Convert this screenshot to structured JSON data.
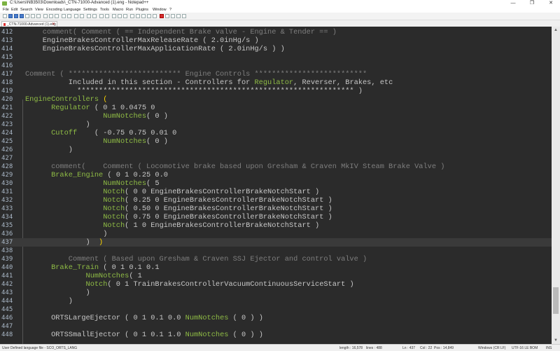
{
  "window": {
    "title": "C:\\Users\\NB3503\\Downloads\\_CTN-71000-Advanced (1).eng - Notepad++",
    "controls": [
      "—",
      "❐",
      "✕"
    ]
  },
  "menu": [
    "File",
    "Edit",
    "Search",
    "View",
    "Encoding",
    "Language",
    "Settings",
    "Tools",
    "Macro",
    "Run",
    "Plugins",
    "Window",
    "?"
  ],
  "tab": {
    "label": "_CTN-71000-Advanced (1).eng",
    "close": "✕"
  },
  "lines": [
    {
      "n": "412",
      "segs": [
        {
          "t": "    comment( Comment ( == Independent Brake valve - Engine & Tender == )",
          "c": "c"
        }
      ]
    },
    {
      "n": "413",
      "segs": [
        {
          "t": "    EngineBrakesControllerMaxReleaseRate ( 2.0inHg/s )",
          "c": "k"
        }
      ]
    },
    {
      "n": "414",
      "segs": [
        {
          "t": "    EngineBrakesControllerMaxApplicationRate ( 2.0inHg/s ) )",
          "c": "k"
        }
      ]
    },
    {
      "n": "415",
      "segs": []
    },
    {
      "n": "416",
      "segs": []
    },
    {
      "n": "417",
      "segs": [
        {
          "t": "Comment ( ************************** Engine Controls **************************",
          "c": "c"
        }
      ]
    },
    {
      "n": "418",
      "segs": [
        {
          "t": "          Included in this section - Controllers for ",
          "c": "k"
        },
        {
          "t": "Regulator",
          "c": "g"
        },
        {
          "t": ", Reverser, Brakes, etc",
          "c": "k"
        }
      ]
    },
    {
      "n": "419",
      "segs": [
        {
          "t": "            **************************************************************** )",
          "c": "k"
        }
      ]
    },
    {
      "n": "420",
      "segs": [
        {
          "t": "EngineControllers ",
          "c": "g"
        },
        {
          "t": "(",
          "c": "y"
        }
      ]
    },
    {
      "n": "421",
      "segs": [
        {
          "t": "      ",
          "c": "k"
        },
        {
          "t": "Regulator",
          "c": "g"
        },
        {
          "t": " ( 0 1 0.0475 0",
          "c": "k"
        }
      ]
    },
    {
      "n": "422",
      "segs": [
        {
          "t": "                  ",
          "c": "k"
        },
        {
          "t": "NumNotches",
          "c": "g"
        },
        {
          "t": "( 0 )",
          "c": "k"
        }
      ]
    },
    {
      "n": "423",
      "segs": [
        {
          "t": "              )",
          "c": "k"
        }
      ]
    },
    {
      "n": "424",
      "segs": [
        {
          "t": "      ",
          "c": "k"
        },
        {
          "t": "Cutoff",
          "c": "g"
        },
        {
          "t": "    ( -0.75 0.75 0.01 0",
          "c": "k"
        }
      ]
    },
    {
      "n": "425",
      "segs": [
        {
          "t": "                  ",
          "c": "k"
        },
        {
          "t": "NumNotches",
          "c": "g"
        },
        {
          "t": "( 0 )",
          "c": "k"
        }
      ]
    },
    {
      "n": "426",
      "segs": [
        {
          "t": "          )",
          "c": "k"
        }
      ]
    },
    {
      "n": "427",
      "segs": []
    },
    {
      "n": "428",
      "segs": [
        {
          "t": "      comment(    Comment ( Locomotive brake based upon Gresham & Craven MkIV Steam Brake Valve )",
          "c": "c"
        }
      ]
    },
    {
      "n": "429",
      "segs": [
        {
          "t": "      ",
          "c": "k"
        },
        {
          "t": "Brake_Engine",
          "c": "g"
        },
        {
          "t": " ( 0 1 0.25 0.0",
          "c": "k"
        }
      ]
    },
    {
      "n": "430",
      "segs": [
        {
          "t": "                  ",
          "c": "k"
        },
        {
          "t": "NumNotches",
          "c": "g"
        },
        {
          "t": "( 5",
          "c": "k"
        }
      ]
    },
    {
      "n": "431",
      "segs": [
        {
          "t": "                  ",
          "c": "k"
        },
        {
          "t": "Notch",
          "c": "g"
        },
        {
          "t": "( 0 0 EngineBrakesControllerBrakeNotchStart )",
          "c": "k"
        }
      ]
    },
    {
      "n": "432",
      "segs": [
        {
          "t": "                  ",
          "c": "k"
        },
        {
          "t": "Notch",
          "c": "g"
        },
        {
          "t": "( 0.25 0 EngineBrakesControllerBrakeNotchStart )",
          "c": "k"
        }
      ]
    },
    {
      "n": "433",
      "segs": [
        {
          "t": "                  ",
          "c": "k"
        },
        {
          "t": "Notch",
          "c": "g"
        },
        {
          "t": "( 0.50 0 EngineBrakesControllerBrakeNotchStart )",
          "c": "k"
        }
      ]
    },
    {
      "n": "434",
      "segs": [
        {
          "t": "                  ",
          "c": "k"
        },
        {
          "t": "Notch",
          "c": "g"
        },
        {
          "t": "( 0.75 0 EngineBrakesControllerBrakeNotchStart )",
          "c": "k"
        }
      ]
    },
    {
      "n": "435",
      "segs": [
        {
          "t": "                  ",
          "c": "k"
        },
        {
          "t": "Notch",
          "c": "g"
        },
        {
          "t": "( 1 0 EngineBrakesControllerBrakeNotchStart )",
          "c": "k"
        }
      ]
    },
    {
      "n": "436",
      "segs": [
        {
          "t": "                  )",
          "c": "k"
        }
      ]
    },
    {
      "n": "437",
      "segs": [
        {
          "t": "              )  ",
          "c": "k"
        },
        {
          "t": ")",
          "c": "y"
        }
      ],
      "current": true
    },
    {
      "n": "438",
      "segs": []
    },
    {
      "n": "439",
      "segs": [
        {
          "t": "          Comment ( Based upon Gresham & Craven SSJ Ejector and control valve )",
          "c": "c"
        }
      ]
    },
    {
      "n": "440",
      "segs": [
        {
          "t": "      ",
          "c": "k"
        },
        {
          "t": "Brake_Train",
          "c": "g"
        },
        {
          "t": " ( 0 1 0.1 0.1",
          "c": "k"
        }
      ]
    },
    {
      "n": "441",
      "segs": [
        {
          "t": "              ",
          "c": "k"
        },
        {
          "t": "NumNotches",
          "c": "g"
        },
        {
          "t": "( 1",
          "c": "k"
        }
      ]
    },
    {
      "n": "442",
      "segs": [
        {
          "t": "              ",
          "c": "k"
        },
        {
          "t": "Notch",
          "c": "g"
        },
        {
          "t": "( 0 1 TrainBrakesControllerVacuumContinuousServiceStart )",
          "c": "k"
        }
      ]
    },
    {
      "n": "443",
      "segs": [
        {
          "t": "              )",
          "c": "k"
        }
      ]
    },
    {
      "n": "444",
      "segs": [
        {
          "t": "          )",
          "c": "k"
        }
      ]
    },
    {
      "n": "445",
      "segs": []
    },
    {
      "n": "446",
      "segs": [
        {
          "t": "      ORTSLargeEjector ( 0 1 0.1 0.0 ",
          "c": "k"
        },
        {
          "t": "NumNotches",
          "c": "g"
        },
        {
          "t": " ( 0 ) )",
          "c": "k"
        }
      ]
    },
    {
      "n": "447",
      "segs": []
    },
    {
      "n": "448",
      "segs": [
        {
          "t": "      ORTSSmallEjector ( 0 1 0.1 1.0 ",
          "c": "k"
        },
        {
          "t": "NumNotches",
          "c": "g"
        },
        {
          "t": " ( 0 ) )",
          "c": "k"
        }
      ]
    }
  ],
  "status": {
    "language": "User Defined language file - SCO_ORTS_LANG",
    "length": "length : 16,578",
    "lines": "lines : 488",
    "ln": "Ln : 437",
    "col": "Col : 22",
    "pos": "Pos : 14,849",
    "eol": "Windows (CR LF)",
    "encoding": "UTF-16 LE BOM",
    "mode": "INS"
  }
}
